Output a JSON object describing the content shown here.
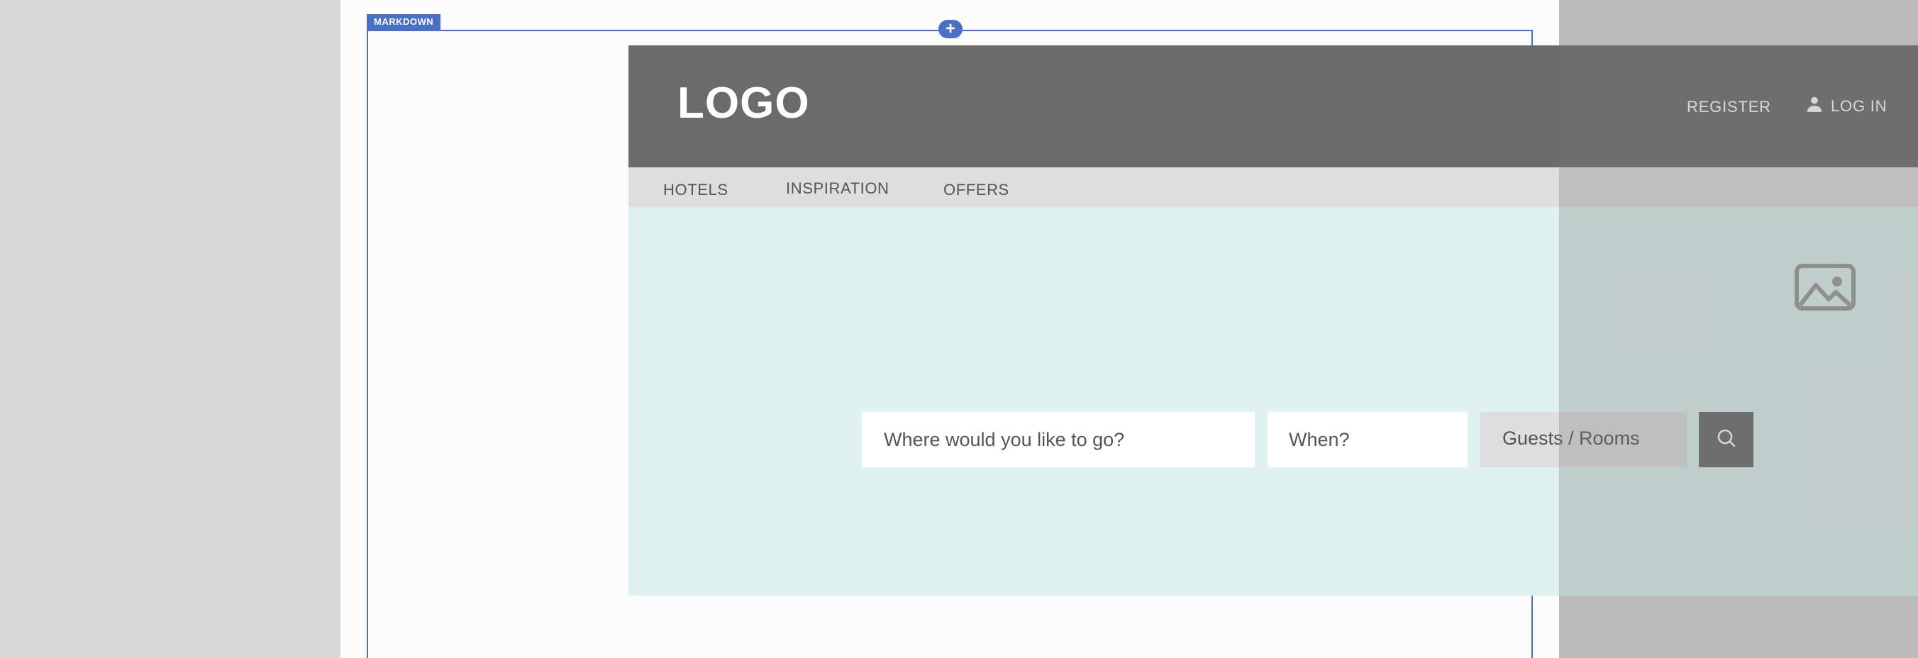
{
  "editor": {
    "block_tag": "MARKDOWN",
    "add_button": "+"
  },
  "site": {
    "logo": "LOGO",
    "header": {
      "register": "REGISTER",
      "login": "LOG IN"
    },
    "nav": [
      {
        "label": "HOTELS"
      },
      {
        "label": "INSPIRATION"
      },
      {
        "label": "OFFERS"
      }
    ],
    "search": {
      "destination_placeholder": "Where would you like to go?",
      "when_placeholder": "When?",
      "guests_placeholder": "Guests / Rooms"
    },
    "icons": {
      "user": "user-icon",
      "image": "image-placeholder-icon",
      "search": "search-icon"
    }
  },
  "colors": {
    "accent": "#4a6fc7",
    "header_bg": "#6b6b6b",
    "nav_bg": "#dedede",
    "hero_bg": "#dff2ef"
  }
}
